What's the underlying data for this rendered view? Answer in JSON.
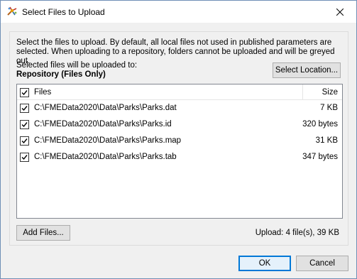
{
  "window": {
    "title": "Select Files to Upload",
    "app_icon": "fme-workbench-icon",
    "close_icon": "close-icon"
  },
  "description": "Select the files to upload. By default, all local files not used in published parameters are selected. When uploading to a repository, folders cannot be uploaded and will be greyed out.",
  "destination": {
    "label": "Selected files will be uploaded to:",
    "value": "Repository (Files Only)",
    "select_button": "Select Location..."
  },
  "file_list": {
    "header_check": true,
    "columns": {
      "files": "Files",
      "size": "Size"
    },
    "rows": [
      {
        "checked": true,
        "path": "C:\\FMEData2020\\Data\\Parks\\Parks.dat",
        "size": "7 KB"
      },
      {
        "checked": true,
        "path": "C:\\FMEData2020\\Data\\Parks\\Parks.id",
        "size": "320 bytes"
      },
      {
        "checked": true,
        "path": "C:\\FMEData2020\\Data\\Parks\\Parks.map",
        "size": "31 KB"
      },
      {
        "checked": true,
        "path": "C:\\FMEData2020\\Data\\Parks\\Parks.tab",
        "size": "347 bytes"
      }
    ]
  },
  "footer": {
    "add_files_button": "Add Files...",
    "upload_summary": "Upload: 4 file(s), 39 KB"
  },
  "dialog_buttons": {
    "ok": "OK",
    "cancel": "Cancel"
  },
  "colors": {
    "accent": "#0078d7",
    "window_bg": "#f0f0f0",
    "list_bg": "#ffffff"
  }
}
